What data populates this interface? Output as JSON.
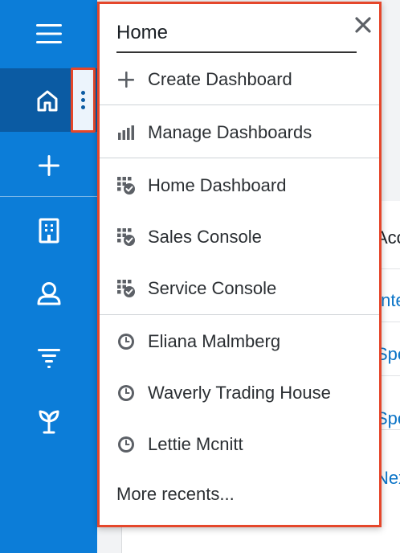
{
  "sidebar": {
    "items": [
      {
        "name": "menu-icon",
        "icon": "hamburger"
      },
      {
        "name": "home-icon",
        "icon": "home"
      },
      {
        "name": "plus-icon",
        "icon": "plus"
      },
      {
        "name": "building-icon",
        "icon": "building"
      },
      {
        "name": "contact-icon",
        "icon": "person"
      },
      {
        "name": "filter-icon",
        "icon": "funnel"
      },
      {
        "name": "sprout-icon",
        "icon": "sprout"
      }
    ],
    "background_color": "#0c7dd8",
    "active_color": "#0b5ba3"
  },
  "menu": {
    "title": "Home",
    "create_label": "Create Dashboard",
    "manage_label": "Manage Dashboards",
    "dashboards": [
      "Home Dashboard",
      "Sales Console",
      "Service Console"
    ],
    "recents": [
      "Eliana Malmberg",
      "Waverly Trading House",
      "Lettie Mcnitt"
    ],
    "more_label": "More recents..."
  },
  "background": {
    "fragments": [
      "Acco",
      "Inte",
      "Spe",
      "Spe",
      "Nex"
    ]
  },
  "highlight_color": "#e5472b"
}
